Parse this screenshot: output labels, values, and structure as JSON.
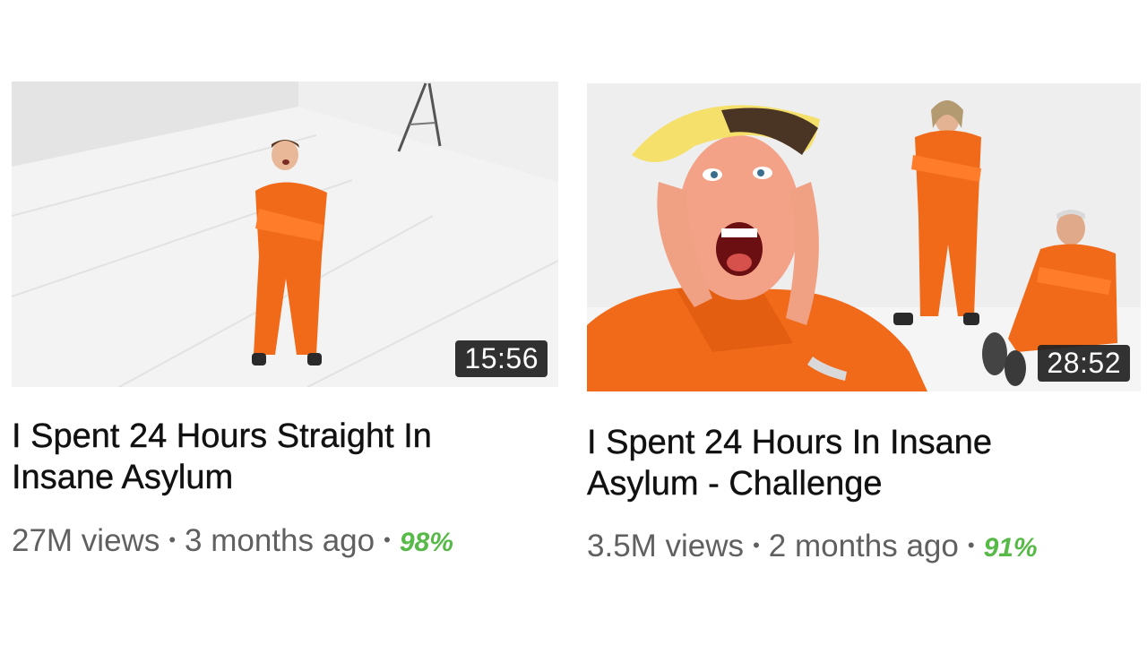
{
  "videos": [
    {
      "duration": "15:56",
      "title_line1": "I Spent 24 Hours Straight In",
      "title_line2": "Insane Asylum",
      "views": "27M views",
      "age": "3 months ago",
      "rating": "98%",
      "separator": "•"
    },
    {
      "duration": "28:52",
      "title_line1": "I Spent 24 Hours In Insane",
      "title_line2": "Asylum - Challenge",
      "views": "3.5M views",
      "age": "2 months ago",
      "rating": "91%",
      "separator": "•"
    }
  ],
  "colors": {
    "background": "#ffffff",
    "title": "#111111",
    "meta": "#606060",
    "rating": "#57b947",
    "duration_badge": "#212121",
    "jumpsuit": "#f06a1a"
  }
}
